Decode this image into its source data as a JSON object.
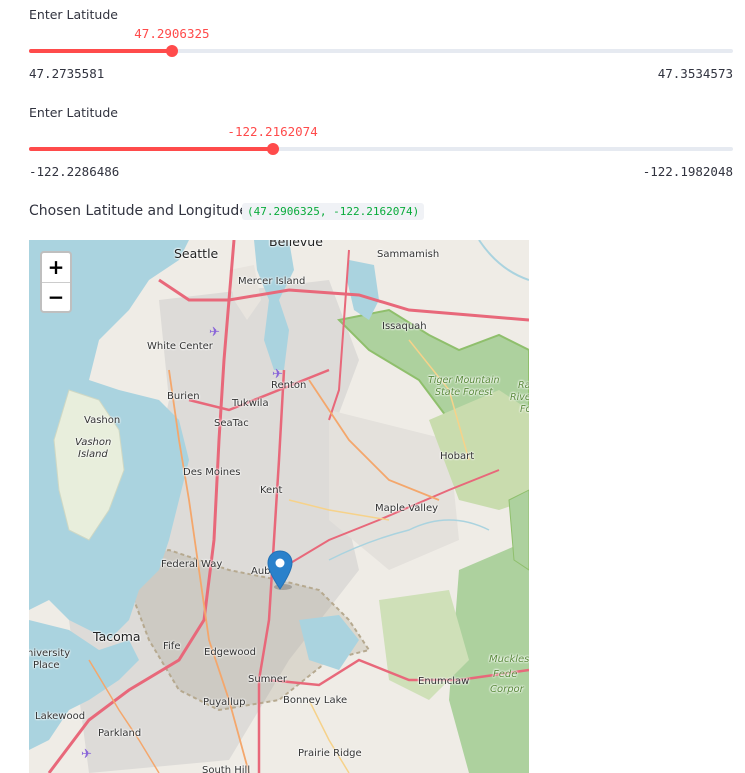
{
  "slider_lat": {
    "label": "Enter Latitude",
    "value": "47.2906325",
    "min": "47.2735581",
    "max": "47.3534573",
    "fraction": 0.203
  },
  "slider_lon": {
    "label": "Enter Latitude",
    "value": "-122.2162074",
    "min": "-122.2286486",
    "max": "-122.1982048",
    "fraction": 0.346
  },
  "chosen": {
    "label": "Chosen Latitude and Longitude",
    "value": "(47.2906325, -122.2162074)"
  },
  "map": {
    "zoom_in": "+",
    "zoom_out": "−",
    "places": {
      "bellevue": "Bellevue",
      "seattle": "Seattle",
      "sammamish": "Sammamish",
      "mercer_island": "Mercer Island",
      "issaquah": "Issaquah",
      "white_center": "White Center",
      "renton": "Renton",
      "tiger_mountain": "Tiger Mountain",
      "state_forest": "State Forest",
      "burien": "Burien",
      "tukwila": "Tukwila",
      "ra": "Ra",
      "river": "River",
      "fo": "Fo",
      "vashon": "Vashon",
      "seatac": "SeaTac",
      "vashon_island_1": "Vashon",
      "vashon_island_2": "Island",
      "hobart": "Hobart",
      "des_moines": "Des Moines",
      "kent": "Kent",
      "maple_valley": "Maple Valley",
      "federal_way": "Federal Way",
      "auburn": "Aub",
      "tacoma": "Tacoma",
      "university_1": "niversity",
      "university_2": "Place",
      "fife": "Fife",
      "edgewood": "Edgewood",
      "muckle_1": "Muckles",
      "muckle_2": "Fede",
      "muckle_3": "Corpor",
      "sumner": "Sumner",
      "enumclaw": "Enumclaw",
      "puyallup": "Puyallup",
      "bonney_lake": "Bonney Lake",
      "lakewood": "Lakewood",
      "parkland": "Parkland",
      "prairie_ridge": "Prairie Ridge",
      "south_hill": "South Hill"
    },
    "colors": {
      "water": "#aad3df",
      "land": "#efece6",
      "urban": "#dddbd8",
      "forest": "#add19e",
      "forest_edge": "#8fbf6c",
      "motorway": "#e8687a",
      "primary": "#f4a76c",
      "secondary": "#f6d28a",
      "marker": "#2a81cb"
    }
  }
}
